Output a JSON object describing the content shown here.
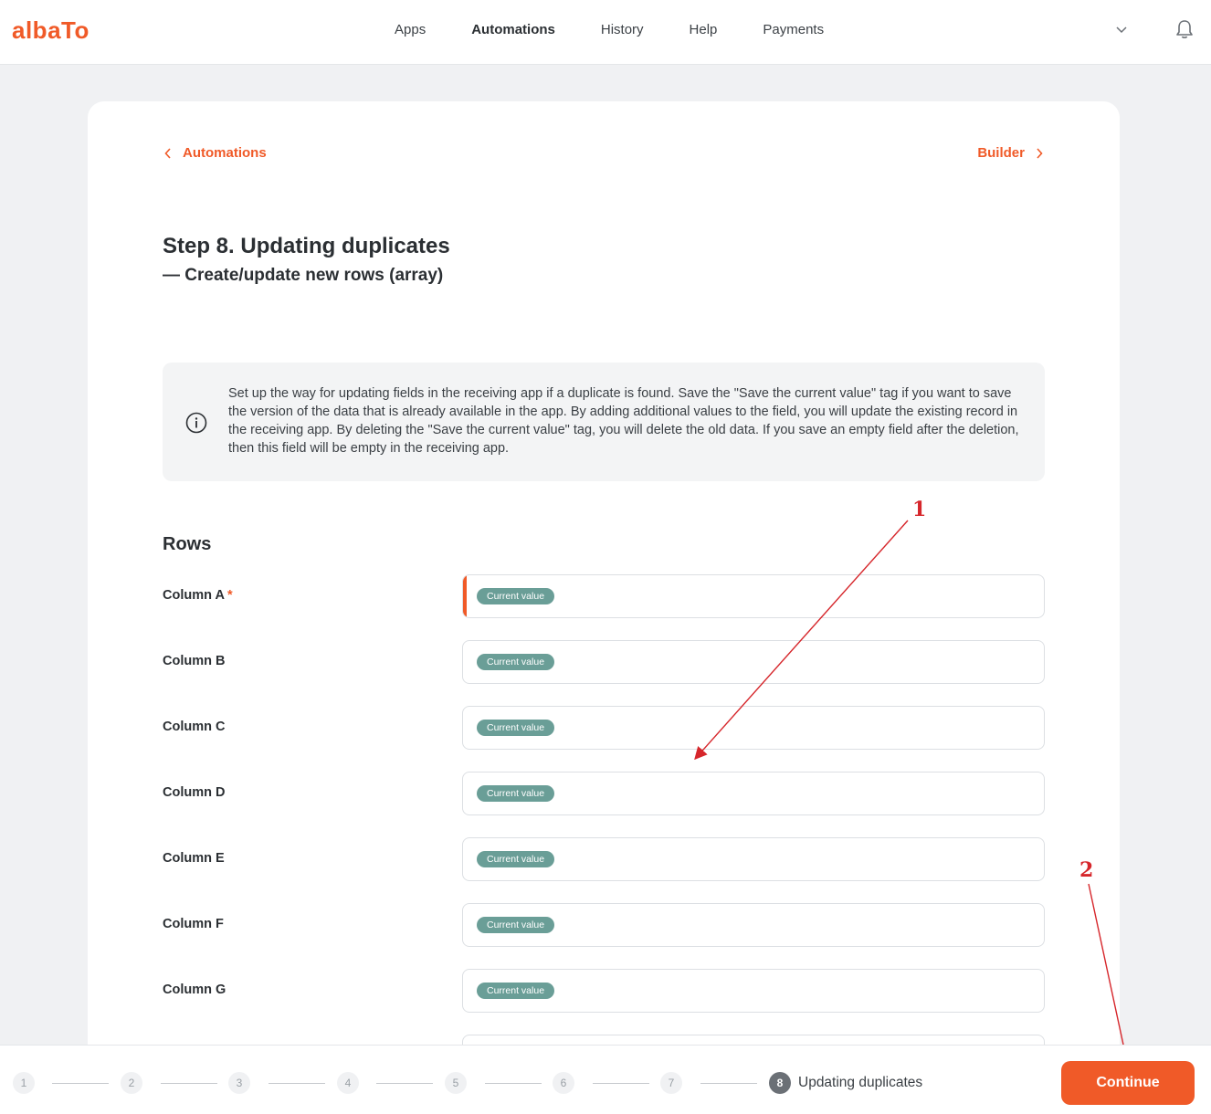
{
  "brand": {
    "logo": "albaTo",
    "accent": "#f05a28"
  },
  "nav": {
    "items": [
      {
        "label": "Apps",
        "active": false
      },
      {
        "label": "Automations",
        "active": true
      },
      {
        "label": "History",
        "active": false
      },
      {
        "label": "Help",
        "active": false
      },
      {
        "label": "Payments",
        "active": false
      }
    ]
  },
  "breadcrumb": {
    "back": "Automations",
    "forward": "Builder"
  },
  "page": {
    "title": "Step 8. Updating duplicates",
    "subtitle": "— Create/update new rows (array)"
  },
  "info": {
    "text": "Set up the way for updating fields in the receiving app if a duplicate is found. Save the \"Save the current value\" tag if you want to save the version of the data that is already available in the app. By adding additional values to the field, you will update the existing record in the receiving app. By deleting the \"Save the current value\" tag, you will delete the old data. If you save an empty field after the deletion, then this field will be empty in the receiving app."
  },
  "rows": {
    "title": "Rows",
    "fields": [
      {
        "label": "Column A",
        "required": true,
        "tag": "Current value"
      },
      {
        "label": "Column B",
        "required": false,
        "tag": "Current value"
      },
      {
        "label": "Column C",
        "required": false,
        "tag": "Current value"
      },
      {
        "label": "Column D",
        "required": false,
        "tag": "Current value"
      },
      {
        "label": "Column E",
        "required": false,
        "tag": "Current value"
      },
      {
        "label": "Column F",
        "required": false,
        "tag": "Current value"
      },
      {
        "label": "Column G",
        "required": false,
        "tag": "Current value"
      }
    ],
    "required_mark": "*"
  },
  "annotations": {
    "one": "1",
    "two": "2",
    "color": "#d6262b"
  },
  "stepper": {
    "steps": [
      "1",
      "2",
      "3",
      "4",
      "5",
      "6",
      "7",
      "8"
    ],
    "current_label": "Updating duplicates",
    "continue": "Continue"
  }
}
